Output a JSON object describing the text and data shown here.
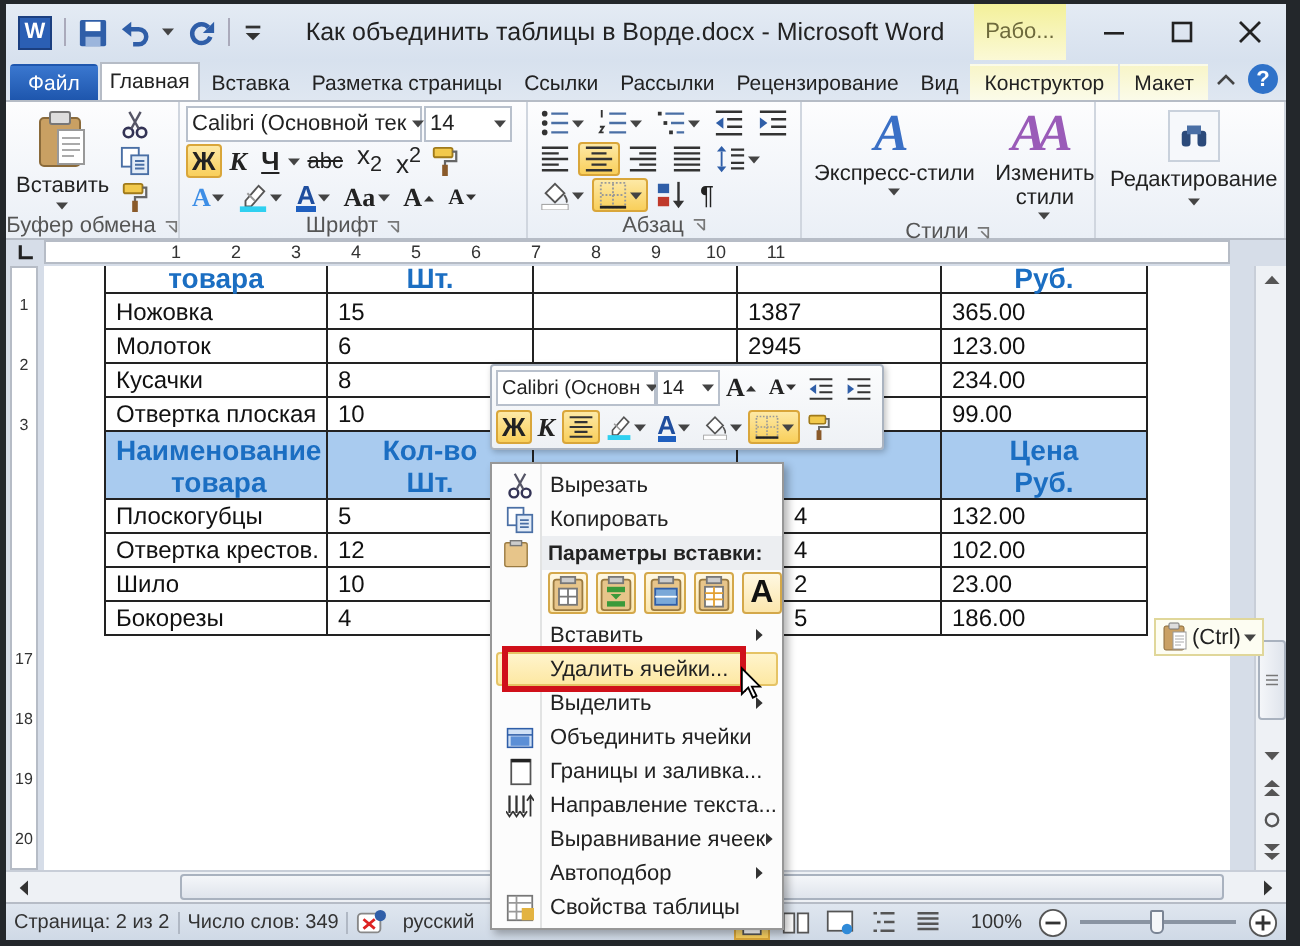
{
  "window": {
    "title": "Как объединить таблицы в Ворде.docx - Microsoft Word",
    "app_icon": "W",
    "contextual_group": "Рабо...",
    "help": "?"
  },
  "tabs": [
    {
      "label": "Файл",
      "kind": "file",
      "selected": false
    },
    {
      "label": "Главная",
      "kind": "normal",
      "selected": true
    },
    {
      "label": "Вставка",
      "kind": "normal",
      "selected": false
    },
    {
      "label": "Разметка страницы",
      "kind": "normal",
      "selected": false
    },
    {
      "label": "Ссылки",
      "kind": "normal",
      "selected": false
    },
    {
      "label": "Рассылки",
      "kind": "normal",
      "selected": false
    },
    {
      "label": "Рецензирование",
      "kind": "normal",
      "selected": false
    },
    {
      "label": "Вид",
      "kind": "normal",
      "selected": false
    },
    {
      "label": "Конструктор",
      "kind": "contextual",
      "selected": false
    },
    {
      "label": "Макет",
      "kind": "contextual",
      "selected": false
    }
  ],
  "ribbon": {
    "clipboard": {
      "label": "Буфер обмена",
      "paste_label": "Вставить"
    },
    "font": {
      "label": "Шрифт",
      "font_name": "Calibri (Основной тек",
      "font_size": "14",
      "style_buttons": [
        {
          "kind": "bold",
          "label": "Ж",
          "selected": true
        },
        {
          "kind": "italic",
          "label": "К",
          "selected": false
        },
        {
          "kind": "underline",
          "label": "Ч",
          "selected": false
        },
        {
          "kind": "strike",
          "label": "abc",
          "selected": false
        },
        {
          "kind": "subscript",
          "label": "x$_{2}$",
          "selected": false
        },
        {
          "kind": "superscript",
          "label": "x$^{2}$",
          "selected": false
        }
      ],
      "effect_buttons": [
        {
          "kind": "effects",
          "label": "A"
        },
        {
          "kind": "highlight"
        },
        {
          "kind": "fontcolor",
          "label": "A"
        },
        {
          "kind": "case",
          "label": "Aa"
        },
        {
          "kind": "grow",
          "label": "A"
        },
        {
          "kind": "shrink",
          "label": "A"
        }
      ]
    },
    "paragraph": {
      "label": "Абзац",
      "rows": [
        [
          {
            "kind": "bullets",
            "selected": false
          },
          {
            "kind": "numbering",
            "selected": false
          },
          {
            "kind": "multilevel",
            "selected": false
          },
          {
            "kind": "outdent",
            "selected": false
          },
          {
            "kind": "indent",
            "selected": false
          }
        ],
        [
          {
            "kind": "alignleft",
            "selected": false
          },
          {
            "kind": "center",
            "selected": true
          },
          {
            "kind": "alignright",
            "selected": false
          },
          {
            "kind": "justify",
            "selected": false
          },
          {
            "kind": "linespacing",
            "selected": false
          }
        ],
        [
          {
            "kind": "shading",
            "selected": false
          },
          {
            "kind": "borders",
            "selected": true
          },
          {
            "kind": "sort",
            "selected": false
          },
          {
            "kind": "pilcrow",
            "label": "¶",
            "selected": false
          }
        ]
      ]
    },
    "styles": {
      "label": "Стили",
      "buttons": [
        {
          "kind": "quick",
          "glyph": "A",
          "label": "Экспресс-стили"
        },
        {
          "kind": "change",
          "glyph": "AA",
          "label": "Изменить стили"
        }
      ]
    },
    "editing": {
      "label": "Редактирование"
    }
  },
  "ruler": {
    "horizontal": [
      "1",
      "2",
      "3",
      "4",
      "5",
      "6",
      "7",
      "8",
      "9",
      "10",
      "11"
    ],
    "vertical": [
      "1",
      "2",
      "3",
      "17",
      "18",
      "19",
      "20"
    ]
  },
  "table": {
    "rows": [
      {
        "kind": "header",
        "selected": false,
        "cells": [
          "товара",
          "Шт.",
          null,
          null,
          "Руб."
        ]
      },
      {
        "kind": "data",
        "selected": false,
        "cells": [
          "Ножовка",
          "15",
          null,
          "1387",
          "365.00"
        ]
      },
      {
        "kind": "data",
        "selected": false,
        "cells": [
          "Молоток",
          "6",
          null,
          "2945",
          "123.00"
        ]
      },
      {
        "kind": "data",
        "selected": false,
        "cells": [
          "Кусачки",
          "8",
          null,
          null,
          "234.00"
        ]
      },
      {
        "kind": "data",
        "selected": false,
        "cells": [
          "Отвертка плоская",
          "10",
          null,
          null,
          "99.00"
        ]
      },
      {
        "kind": "header",
        "selected": true,
        "cells": [
          "Наименование товара",
          "Кол-во Шт.",
          null,
          null,
          "Цена Руб."
        ]
      },
      {
        "kind": "data",
        "selected": false,
        "cells": [
          "Плоскогубцы",
          "5",
          null,
          "4",
          "132.00"
        ]
      },
      {
        "kind": "data",
        "selected": false,
        "cells": [
          "Отвертка крестов.",
          "12",
          null,
          "4",
          "102.00"
        ]
      },
      {
        "kind": "data",
        "selected": false,
        "cells": [
          "Шило",
          "10",
          null,
          "2",
          "23.00"
        ]
      },
      {
        "kind": "data",
        "selected": false,
        "cells": [
          "Бокорезы",
          "4",
          null,
          "5",
          "186.00"
        ]
      }
    ]
  },
  "mini_toolbar": {
    "font_name": "Calibri (Основн",
    "font_size": "14",
    "row1_buttons": [
      {
        "kind": "grow",
        "label": "A"
      },
      {
        "kind": "shrink",
        "label": "A"
      },
      {
        "kind": "outdent"
      },
      {
        "kind": "indent"
      }
    ],
    "row2_buttons": [
      {
        "kind": "bold",
        "label": "Ж",
        "selected": true
      },
      {
        "kind": "italic",
        "label": "К",
        "selected": false
      },
      {
        "kind": "center",
        "selected": true
      },
      {
        "kind": "highlight",
        "selected": false
      },
      {
        "kind": "fontcolor",
        "label": "A",
        "selected": false
      },
      {
        "kind": "shading",
        "selected": false
      },
      {
        "kind": "borders",
        "selected": true
      },
      {
        "kind": "painter",
        "selected": false
      }
    ]
  },
  "context_menu": {
    "items": [
      {
        "kind": "cut",
        "label": "Вырезать",
        "submenu": false,
        "highlighted": false,
        "outlined": false
      },
      {
        "kind": "copy",
        "label": "Копировать",
        "submenu": false,
        "highlighted": false,
        "outlined": false
      },
      {
        "kind": "pasteheader",
        "label": "Параметры вставки:"
      },
      {
        "kind": "pasteoptions",
        "options": [
          {
            "kind": "keep"
          },
          {
            "kind": "merge"
          },
          {
            "kind": "nest"
          },
          {
            "kind": "overwrite"
          },
          {
            "kind": "text",
            "label": "A"
          }
        ]
      },
      {
        "kind": "insert",
        "label": "Вставить",
        "submenu": true,
        "highlighted": false,
        "outlined": false
      },
      {
        "kind": "delete",
        "label": "Удалить ячейки...",
        "submenu": false,
        "highlighted": true,
        "outlined": true
      },
      {
        "kind": "select",
        "label": "Выделить",
        "submenu": true,
        "highlighted": false,
        "outlined": false
      },
      {
        "kind": "merge",
        "label": "Объединить ячейки",
        "submenu": false,
        "highlighted": false,
        "outlined": false
      },
      {
        "kind": "borders",
        "label": "Границы и заливка...",
        "submenu": false,
        "highlighted": false,
        "outlined": false
      },
      {
        "kind": "direction",
        "label": "Направление текста...",
        "submenu": false,
        "highlighted": false,
        "outlined": false
      },
      {
        "kind": "align",
        "label": "Выравнивание ячеек",
        "submenu": true,
        "highlighted": false,
        "outlined": false
      },
      {
        "kind": "autofit",
        "label": "Автоподбор",
        "submenu": true,
        "highlighted": false,
        "outlined": false
      },
      {
        "kind": "properties",
        "label": "Свойства таблицы",
        "submenu": false,
        "highlighted": false,
        "outlined": false
      }
    ]
  },
  "paste_options_button": {
    "label": "(Ctrl)"
  },
  "status_bar": {
    "page": "Страница: 2 из 2",
    "words": "Число слов: 349",
    "language": "русский",
    "views": [
      {
        "kind": "print",
        "selected": true
      },
      {
        "kind": "reading",
        "selected": false
      },
      {
        "kind": "web",
        "selected": false
      },
      {
        "kind": "outline",
        "selected": false
      },
      {
        "kind": "draft",
        "selected": false
      }
    ],
    "zoom": "100%",
    "zoom_slider": {
      "level": 0.5
    }
  }
}
